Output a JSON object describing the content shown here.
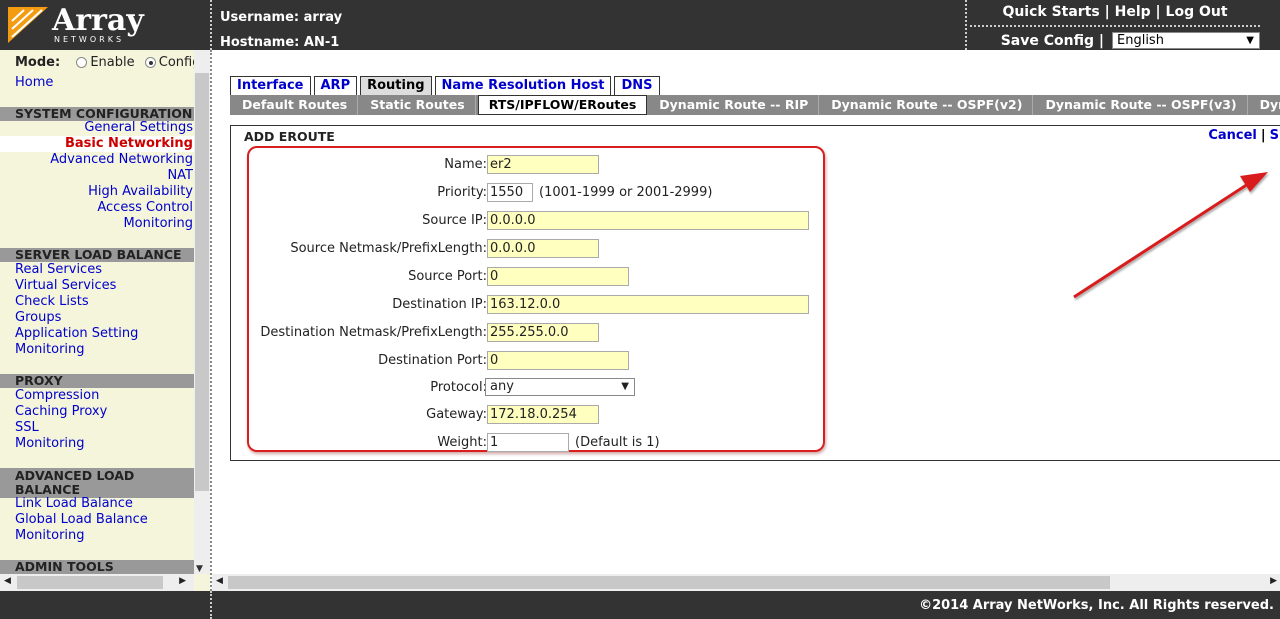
{
  "header": {
    "brand": "Array",
    "brand_sub": "NETWORKS",
    "username_label": "Username:",
    "username": "array",
    "hostname_label": "Hostname:",
    "hostname": "AN-1",
    "quick_starts": "Quick Starts",
    "help": "Help",
    "logout": "Log Out",
    "sep": "|",
    "save_config": "Save Config",
    "language": "English"
  },
  "sidebar": {
    "mode_label": "Mode:",
    "mode_enable": "Enable",
    "mode_config": "Config",
    "home": "Home",
    "sections": [
      {
        "title": "SYSTEM CONFIGURATION",
        "items": [
          "General Settings",
          "Basic Networking",
          "Advanced Networking",
          "NAT",
          "High Availability",
          "Access Control",
          "Monitoring"
        ]
      },
      {
        "title": "SERVER LOAD BALANCE",
        "items": [
          "Real Services",
          "Virtual Services",
          "Check Lists",
          "Groups",
          "Application Setting",
          "Monitoring"
        ]
      },
      {
        "title": "PROXY",
        "items": [
          "Compression",
          "Caching Proxy",
          "SSL",
          "Monitoring"
        ]
      },
      {
        "title": "ADVANCED LOAD BALANCE",
        "items": [
          "Link Load Balance",
          "Global Load Balance",
          "Monitoring"
        ]
      },
      {
        "title": "ADMIN TOOLS",
        "items": []
      }
    ]
  },
  "tabs": [
    "Interface",
    "ARP",
    "Routing",
    "Name Resolution Host",
    "DNS"
  ],
  "subtabs": [
    "Default Routes",
    "Static Routes",
    "RTS/IPFLOW/ERoutes",
    "Dynamic Route -- RIP",
    "Dynamic Route -- OSPF(v2)",
    "Dynamic Route -- OSPF(v3)",
    "Dynamic"
  ],
  "panel": {
    "title": "ADD EROUTE",
    "cancel": "Cancel",
    "sep": "|",
    "save": "S"
  },
  "form": {
    "name": {
      "label": "Name:",
      "value": "er2"
    },
    "priority": {
      "label": "Priority:",
      "value": "1550",
      "hint": "(1001-1999 or 2001-2999)"
    },
    "source_ip": {
      "label": "Source IP:",
      "value": "0.0.0.0"
    },
    "source_mask": {
      "label": "Source Netmask/PrefixLength:",
      "value": "0.0.0.0"
    },
    "source_port": {
      "label": "Source Port:",
      "value": "0"
    },
    "dest_ip": {
      "label": "Destination IP:",
      "value": "163.12.0.0"
    },
    "dest_mask": {
      "label": "Destination Netmask/PrefixLength:",
      "value": "255.255.0.0"
    },
    "dest_port": {
      "label": "Destination Port:",
      "value": "0"
    },
    "protocol": {
      "label": "Protocol:",
      "value": "any"
    },
    "gateway": {
      "label": "Gateway:",
      "value": "172.18.0.254"
    },
    "weight": {
      "label": "Weight:",
      "value": "1",
      "hint": "(Default is 1)"
    }
  },
  "footer": {
    "copyright": "©2014 Array NetWorks, Inc. All Rights reserved."
  },
  "colors": {
    "header_bg": "#333333",
    "sidebar_bg": "#f5f5dc",
    "link": "#0000cc",
    "active": "#cc0000",
    "field_bg": "#ffffc0",
    "highlight": "#d81e1e",
    "logo_orange": "#f39c12"
  }
}
